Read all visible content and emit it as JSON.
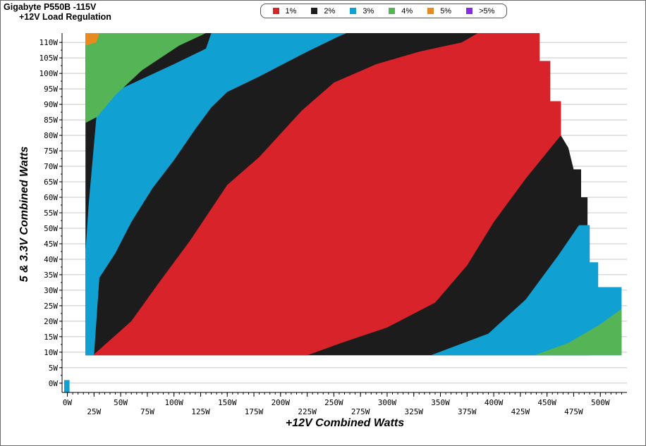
{
  "chart_data": {
    "type": "heatmap",
    "title": "Gigabyte P550B -115V",
    "subtitle": "+12V Load Regulation",
    "xlabel": "+12V Combined Watts",
    "ylabel": "5 & 3.3V Combined Watts",
    "xlim": [
      -5,
      525
    ],
    "ylim": [
      -3,
      113
    ],
    "x_ticks": [
      "0W",
      "25W",
      "50W",
      "75W",
      "100W",
      "125W",
      "150W",
      "175W",
      "200W",
      "225W",
      "250W",
      "275W",
      "300W",
      "325W",
      "350W",
      "375W",
      "400W",
      "425W",
      "450W",
      "475W",
      "500W"
    ],
    "y_ticks": [
      "0W",
      "5W",
      "10W",
      "15W",
      "20W",
      "25W",
      "30W",
      "35W",
      "40W",
      "45W",
      "50W",
      "55W",
      "60W",
      "65W",
      "70W",
      "75W",
      "80W",
      "85W",
      "90W",
      "95W",
      "100W",
      "105W",
      "110W"
    ],
    "legend": [
      {
        "label": "1%",
        "color": "#d8232a"
      },
      {
        "label": "2%",
        "color": "#1c1c1c"
      },
      {
        "label": "3%",
        "color": "#11a0d2"
      },
      {
        "label": "4%",
        "color": "#55b455"
      },
      {
        "label": "5%",
        "color": "#e88a20"
      },
      {
        "label": ">5%",
        "color": "#8a2be2"
      }
    ],
    "legend_position": "top-center",
    "grid": true,
    "regions": [
      {
        "deviation": "2%",
        "y_range": [
          9,
          113
        ],
        "x_range": [
          17,
          520
        ]
      },
      {
        "deviation": "3%",
        "boundary": [
          [
            17,
            42
          ],
          [
            20,
            58
          ],
          [
            28,
            89
          ],
          [
            50,
            95
          ],
          [
            100,
            103
          ],
          [
            130,
            108
          ],
          [
            135,
            113
          ],
          [
            262,
            113
          ],
          [
            255,
            112
          ],
          [
            225,
            107
          ],
          [
            180,
            99
          ],
          [
            150,
            94
          ],
          [
            135,
            89
          ],
          [
            120,
            82
          ],
          [
            100,
            72
          ],
          [
            80,
            63
          ],
          [
            60,
            52
          ],
          [
            45,
            42
          ],
          [
            30,
            34
          ],
          [
            25,
            9
          ],
          [
            17,
            9
          ]
        ]
      },
      {
        "deviation": "1%",
        "boundary": [
          [
            24,
            9
          ],
          [
            60,
            20
          ],
          [
            85,
            32
          ],
          [
            115,
            46
          ],
          [
            150,
            64
          ],
          [
            180,
            73
          ],
          [
            220,
            88
          ],
          [
            250,
            97
          ],
          [
            290,
            103
          ],
          [
            330,
            107
          ],
          [
            370,
            110
          ],
          [
            385,
            113
          ],
          [
            443,
            113
          ],
          [
            443,
            104
          ],
          [
            453,
            104
          ],
          [
            453,
            91
          ],
          [
            463,
            91
          ],
          [
            463,
            80
          ],
          [
            430,
            66
          ],
          [
            400,
            52
          ],
          [
            375,
            38
          ],
          [
            345,
            26
          ],
          [
            300,
            18
          ],
          [
            257,
            13
          ],
          [
            225,
            9
          ]
        ]
      },
      {
        "deviation": "3%",
        "boundary": [
          [
            341,
            9
          ],
          [
            395,
            16
          ],
          [
            430,
            27
          ],
          [
            460,
            41
          ],
          [
            480,
            51
          ],
          [
            490,
            51
          ],
          [
            490,
            39
          ],
          [
            498,
            39
          ],
          [
            498,
            31
          ],
          [
            520,
            31
          ],
          [
            520,
            9
          ]
        ]
      },
      {
        "deviation": "4%",
        "boundary": [
          [
            438,
            9
          ],
          [
            470,
            13
          ],
          [
            500,
            19
          ],
          [
            520,
            24
          ],
          [
            520,
            9
          ]
        ]
      },
      {
        "deviation": "4%",
        "boundary": [
          [
            17,
            84
          ],
          [
            28,
            86
          ],
          [
            45,
            93
          ],
          [
            70,
            101
          ],
          [
            105,
            109
          ],
          [
            130,
            113
          ],
          [
            17,
            113
          ]
        ]
      },
      {
        "deviation": "5%",
        "boundary": [
          [
            17,
            109
          ],
          [
            27,
            110
          ],
          [
            30,
            113
          ],
          [
            17,
            113
          ]
        ]
      },
      {
        "deviation": "3%",
        "boundary": [
          [
            -3,
            -3
          ],
          [
            2,
            -3
          ],
          [
            2,
            1
          ],
          [
            -3,
            1
          ]
        ]
      }
    ]
  }
}
